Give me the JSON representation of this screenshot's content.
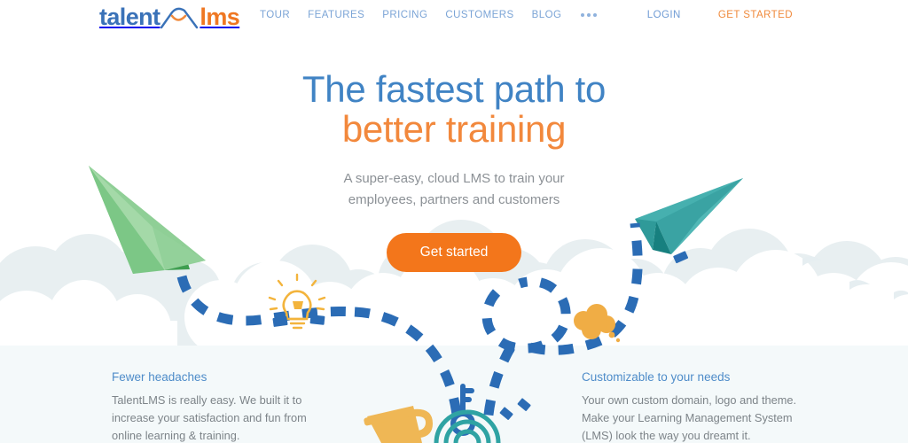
{
  "header": {
    "logo": {
      "text_primary": "talent",
      "text_secondary": "lms",
      "mark_name": "cloud-smile-icon",
      "color_primary": "#3a72b8",
      "color_secondary": "#ef7722"
    },
    "nav": [
      {
        "label": "TOUR"
      },
      {
        "label": "FEATURES"
      },
      {
        "label": "PRICING"
      },
      {
        "label": "CUSTOMERS"
      },
      {
        "label": "BLOG"
      }
    ],
    "more_label": "•••",
    "login_label": "LOGIN",
    "get_started_label": "GET STARTED",
    "nav_color": "#7ba4d6",
    "accent_color": "#f08a3c"
  },
  "hero": {
    "headline_line1": "The fastest path to",
    "headline_line2": "better training",
    "headline_color1": "#4083c4",
    "headline_color2": "#f2883c",
    "subtitle_line1": "A super-easy, cloud LMS to train your",
    "subtitle_line2": "employees, partners and customers",
    "cta_label": "Get started",
    "cta_color": "#f3761b"
  },
  "illustration": {
    "plane_left_name": "green-paper-plane",
    "plane_left_color": "#84c98c",
    "plane_right_name": "teal-paper-plane",
    "plane_right_color": "#3aa8a8",
    "trail_color": "#2b6cb5",
    "lightbulb_name": "lightbulb-icon",
    "lightbulb_color": "#f3b43c",
    "thought_cloud_name": "orange-cloud-icon",
    "thought_cloud_color": "#f0ad45",
    "key_name": "key-icon",
    "key_color": "#2b6cb5",
    "trophy_name": "trophy-icon",
    "trophy_color": "#efb755",
    "arcs_name": "signal-arcs-icon",
    "arcs_color": "#2fa3a3",
    "cloud_fill_a": "#e8eff1",
    "cloud_fill_b": "#ffffff",
    "band_fill": "#f4f9fa"
  },
  "features": [
    {
      "title": "Fewer headaches",
      "body_line1": "TalentLMS is really easy. We built it to",
      "body_line2": "increase your satisfaction and fun from",
      "body_line3": "online learning & training."
    },
    {
      "title": "Customizable to your needs",
      "body_line1": "Your own custom domain, logo and theme.",
      "body_line2": "Make your Learning Management System",
      "body_line3": "(LMS) look the way you dreamt it."
    }
  ]
}
